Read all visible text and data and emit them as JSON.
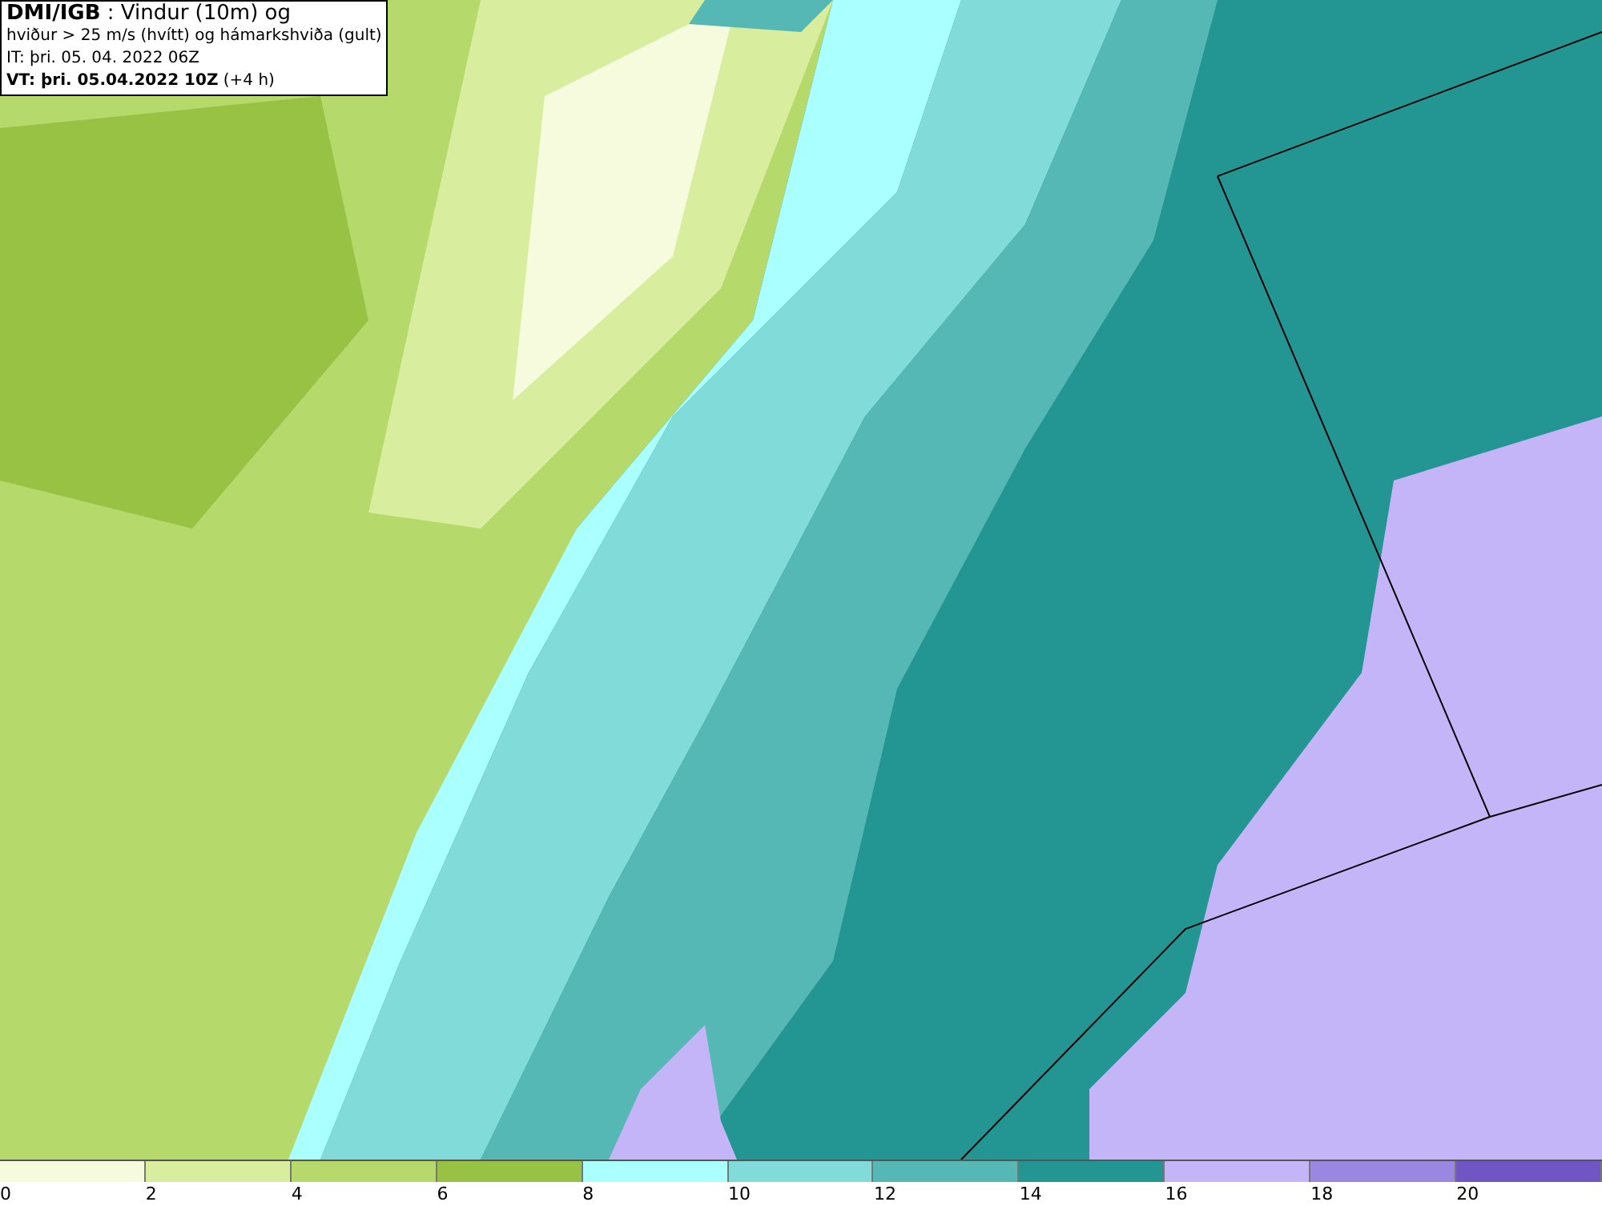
{
  "header": {
    "lines": [
      "**DMI/IGB** : Vindur (10m) og",
      "hviður > 25 m/s (hvítt) og hámarkshviða (gult)",
      "IT: þri. 05. 04. 2022 06Z",
      "**VT: þri. 05.04.2022 10Z** (+4 h)"
    ]
  },
  "legend": [
    {
      "color": "#f5fbdc",
      "label": "0"
    },
    {
      "color": "#d8ee9e",
      "label": "2"
    },
    {
      "color": "#b6d96c",
      "label": "4"
    },
    {
      "color": "#98c244",
      "label": "6"
    },
    {
      "color": "#aaffff",
      "label": "8"
    },
    {
      "color": "#80dbd9",
      "label": "10"
    },
    {
      "color": "#56b8b5",
      "label": "12"
    },
    {
      "color": "#239592",
      "label": "14"
    },
    {
      "color": "#c4b5f9",
      "label": "16"
    },
    {
      "color": "#9a87e2",
      "label": "18"
    },
    {
      "color": "#7055c4",
      "label": "20"
    }
  ]
}
